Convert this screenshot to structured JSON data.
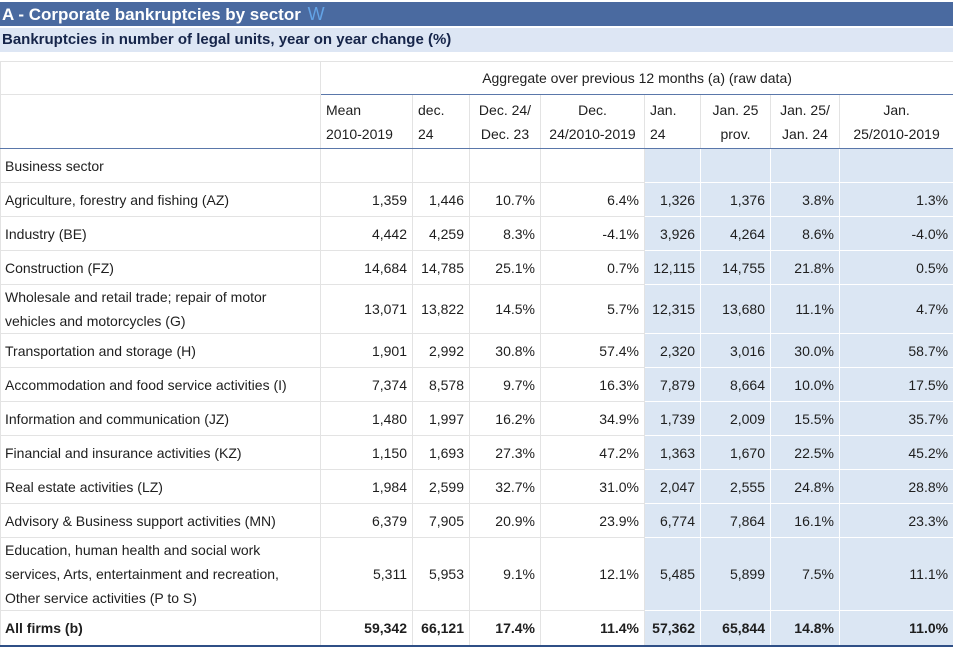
{
  "title": "A - Corporate bankruptcies by sector",
  "title_icon": "w-logo-icon",
  "subtitle": "Bankruptcies in number of legal units, year on year change (%)",
  "aggregate_header": "Aggregate over previous 12 months (a) (raw data)",
  "columns": [
    {
      "line1": "Mean",
      "line2": "2010-2019"
    },
    {
      "line1": "dec.",
      "line2": "24"
    },
    {
      "line1": "Dec. 24/",
      "line2": "Dec. 23"
    },
    {
      "line1": "Dec.",
      "line2": "24/2010-2019"
    },
    {
      "line1": "Jan.",
      "line2": "24"
    },
    {
      "line1": "Jan. 25",
      "line2": "prov."
    },
    {
      "line1": "Jan. 25/",
      "line2": "Jan. 24"
    },
    {
      "line1": "Jan.",
      "line2": "25/2010-2019"
    }
  ],
  "sector_header": "Business sector",
  "rows": [
    {
      "label": "Agriculture, forestry and fishing (AZ)",
      "values": [
        "1,359",
        "1,446",
        "10.7%",
        "6.4%",
        "1,326",
        "1,376",
        "3.8%",
        "1.3%"
      ]
    },
    {
      "label": "Industry (BE)",
      "values": [
        "4,442",
        "4,259",
        "8.3%",
        "-4.1%",
        "3,926",
        "4,264",
        "8.6%",
        "-4.0%"
      ]
    },
    {
      "label": "Construction (FZ)",
      "values": [
        "14,684",
        "14,785",
        "25.1%",
        "0.7%",
        "12,115",
        "14,755",
        "21.8%",
        "0.5%"
      ]
    },
    {
      "label": "Wholesale and retail trade; repair of motor vehicles and motorcycles (G)",
      "values": [
        "13,071",
        "13,822",
        "14.5%",
        "5.7%",
        "12,315",
        "13,680",
        "11.1%",
        "4.7%"
      ]
    },
    {
      "label": "Transportation and storage (H)",
      "values": [
        "1,901",
        "2,992",
        "30.8%",
        "57.4%",
        "2,320",
        "3,016",
        "30.0%",
        "58.7%"
      ]
    },
    {
      "label": "Accommodation and food service activities (I)",
      "values": [
        "7,374",
        "8,578",
        "9.7%",
        "16.3%",
        "7,879",
        "8,664",
        "10.0%",
        "17.5%"
      ]
    },
    {
      "label": "Information and communication (JZ)",
      "values": [
        "1,480",
        "1,997",
        "16.2%",
        "34.9%",
        "1,739",
        "2,009",
        "15.5%",
        "35.7%"
      ]
    },
    {
      "label": "Financial and insurance activities (KZ)",
      "values": [
        "1,150",
        "1,693",
        "27.3%",
        "47.2%",
        "1,363",
        "1,670",
        "22.5%",
        "45.2%"
      ]
    },
    {
      "label": "Real estate activities (LZ)",
      "values": [
        "1,984",
        "2,599",
        "32.7%",
        "31.0%",
        "2,047",
        "2,555",
        "24.8%",
        "28.8%"
      ]
    },
    {
      "label": "Advisory & Business support activities (MN)",
      "values": [
        "6,379",
        "7,905",
        "20.9%",
        "23.9%",
        "6,774",
        "7,864",
        "16.1%",
        "23.3%"
      ]
    },
    {
      "label": "Education, human health and social work services, Arts, entertainment and recreation, Other service activities (P to S)",
      "values": [
        "5,311",
        "5,953",
        "9.1%",
        "12.1%",
        "5,485",
        "5,899",
        "7.5%",
        "11.1%"
      ]
    }
  ],
  "total": {
    "label": "All firms (b)",
    "values": [
      "59,342",
      "66,121",
      "17.4%",
      "11.4%",
      "57,362",
      "65,844",
      "14.8%",
      "11.0%"
    ]
  },
  "colors": {
    "title_bg": "#4a6aa0",
    "subtitle_bg": "#dde6f4",
    "highlight_bg": "#dbe6f3",
    "accent_icon": "#63a3e6"
  }
}
